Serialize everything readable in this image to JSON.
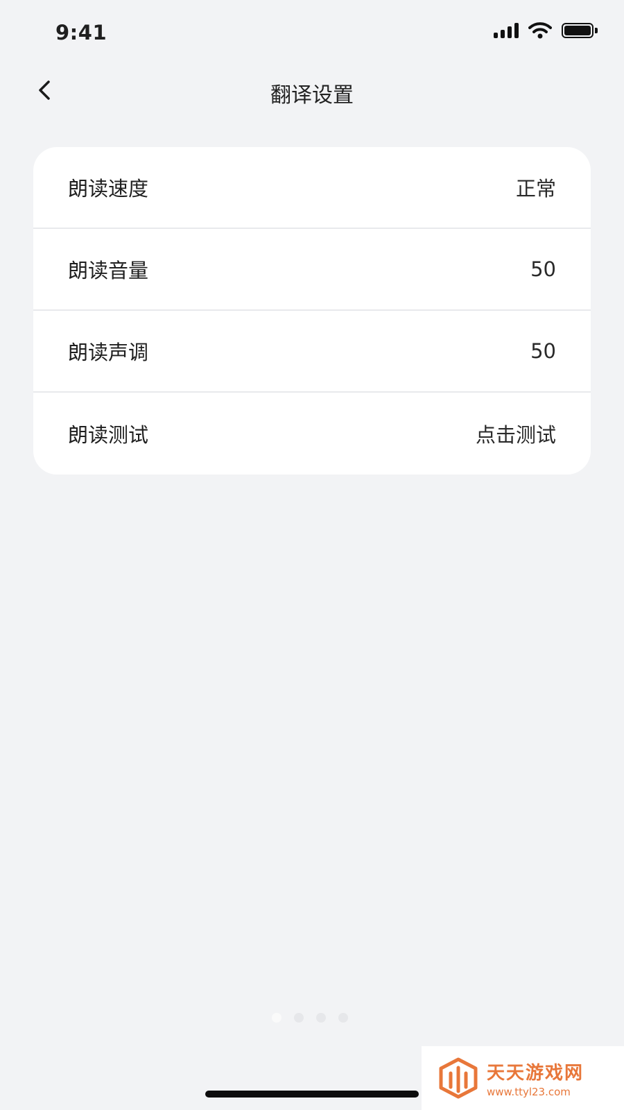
{
  "status_bar": {
    "time": "9:41"
  },
  "header": {
    "title": "翻译设置"
  },
  "settings": [
    {
      "label": "朗读速度",
      "value": "正常"
    },
    {
      "label": "朗读音量",
      "value": "50"
    },
    {
      "label": "朗读声调",
      "value": "50"
    },
    {
      "label": "朗读测试",
      "value": "点击测试"
    }
  ],
  "pager": {
    "count": 4,
    "active_index": 0
  },
  "watermark": {
    "name": "天天游戏网",
    "url": "www.ttyl23.com",
    "color": "#e8773a"
  },
  "colors": {
    "background": "#f2f3f5",
    "card": "#ffffff",
    "text": "#1f1f1f"
  }
}
